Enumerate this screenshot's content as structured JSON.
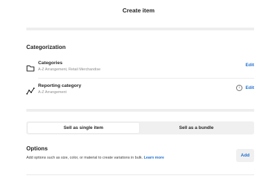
{
  "header": {
    "title": "Create item"
  },
  "categorization": {
    "heading": "Categorization",
    "rows": [
      {
        "label": "Categories",
        "detail": "A-Z Arrangement, Retail Merchandise",
        "action": "Edit",
        "icon": "folder-icon"
      },
      {
        "label": "Reporting category",
        "detail": "A-Z Arrangement",
        "action": "Edit",
        "icon": "trend-line-icon",
        "info_icon": "i"
      }
    ]
  },
  "sell_mode": {
    "options": [
      "Sell as single item",
      "Sell as a bundle"
    ],
    "selected": "Sell as single item"
  },
  "options_section": {
    "heading": "Options",
    "description": "Add options such as size, color, or material to create variations in bulk.",
    "learn_more": "Learn more",
    "add_label": "Add"
  },
  "colors": {
    "accent": "#1f6fd1",
    "bar": "#eeeeee"
  }
}
